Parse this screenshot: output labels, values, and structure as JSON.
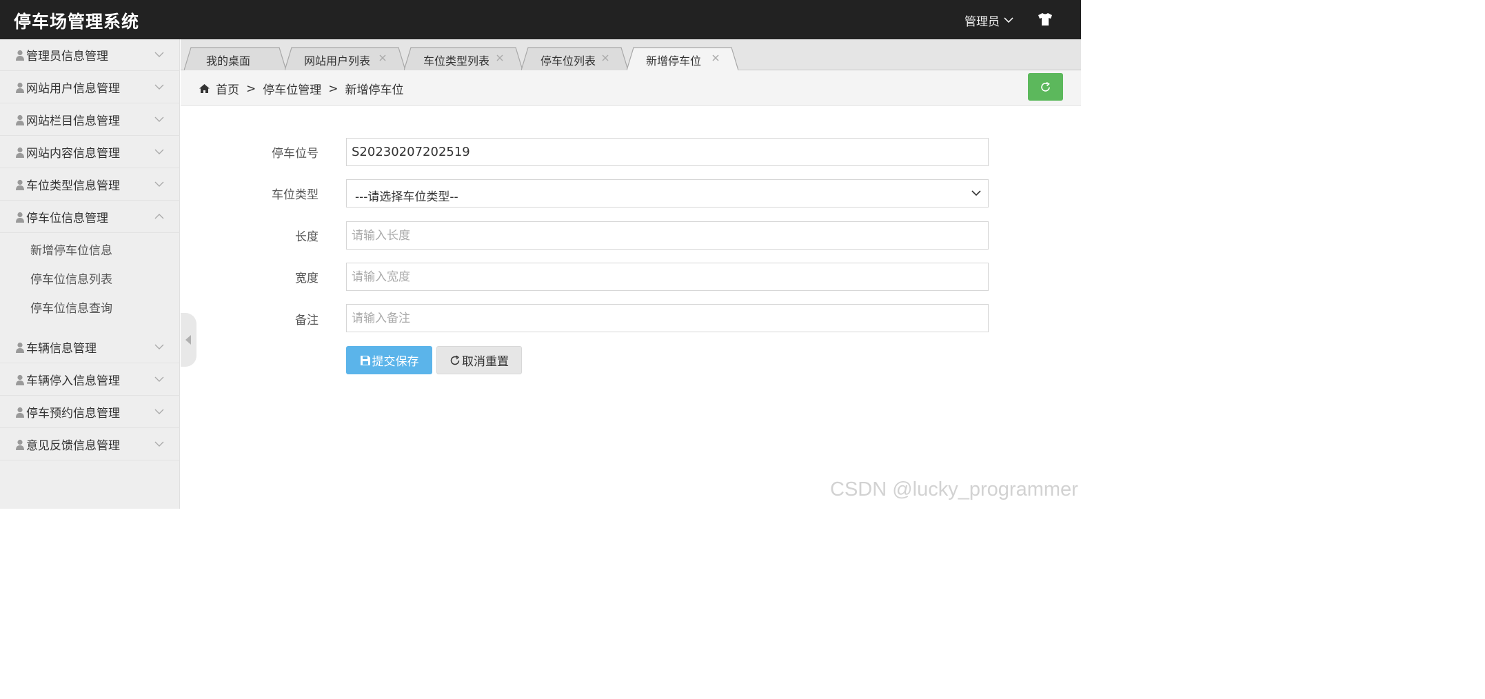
{
  "header": {
    "app_title": "停车场管理系统",
    "user_label": "管理员",
    "theme_icon": "tshirt-icon"
  },
  "sidebar": {
    "items": [
      {
        "label": "管理员信息管理",
        "expanded": false
      },
      {
        "label": "网站用户信息管理",
        "expanded": false
      },
      {
        "label": "网站栏目信息管理",
        "expanded": false
      },
      {
        "label": "网站内容信息管理",
        "expanded": false
      },
      {
        "label": "车位类型信息管理",
        "expanded": false
      },
      {
        "label": "停车位信息管理",
        "expanded": true,
        "children": [
          "新增停车位信息",
          "停车位信息列表",
          "停车位信息查询"
        ]
      },
      {
        "label": "车辆信息管理",
        "expanded": false
      },
      {
        "label": "车辆停入信息管理",
        "expanded": false
      },
      {
        "label": "停车预约信息管理",
        "expanded": false
      },
      {
        "label": "意见反馈信息管理",
        "expanded": false
      }
    ]
  },
  "tabs": [
    {
      "label": "我的桌面",
      "closable": false,
      "active": false
    },
    {
      "label": "网站用户列表",
      "closable": true,
      "active": false
    },
    {
      "label": "车位类型列表",
      "closable": true,
      "active": false
    },
    {
      "label": "停车位列表",
      "closable": true,
      "active": false
    },
    {
      "label": "新增停车位",
      "closable": true,
      "active": true
    }
  ],
  "breadcrumb": {
    "home": "首页",
    "level1": "停车位管理",
    "level2": "新增停车位",
    "sep1": ">",
    "sep2": ">"
  },
  "form": {
    "spot_no": {
      "label": "停车位号",
      "value": "S20230207202519"
    },
    "spot_type": {
      "label": "车位类型",
      "selected": "---请选择车位类型--"
    },
    "length": {
      "label": "长度",
      "placeholder": "请输入长度"
    },
    "width": {
      "label": "宽度",
      "placeholder": "请输入宽度"
    },
    "remark": {
      "label": "备注",
      "placeholder": "请输入备注"
    },
    "save_label": "提交保存",
    "reset_label": "取消重置"
  },
  "colors": {
    "header_bg": "#222222",
    "save_button": "#5bb4ea",
    "refresh_button": "#5cb85c"
  },
  "watermark": "CSDN @lucky_programmer"
}
